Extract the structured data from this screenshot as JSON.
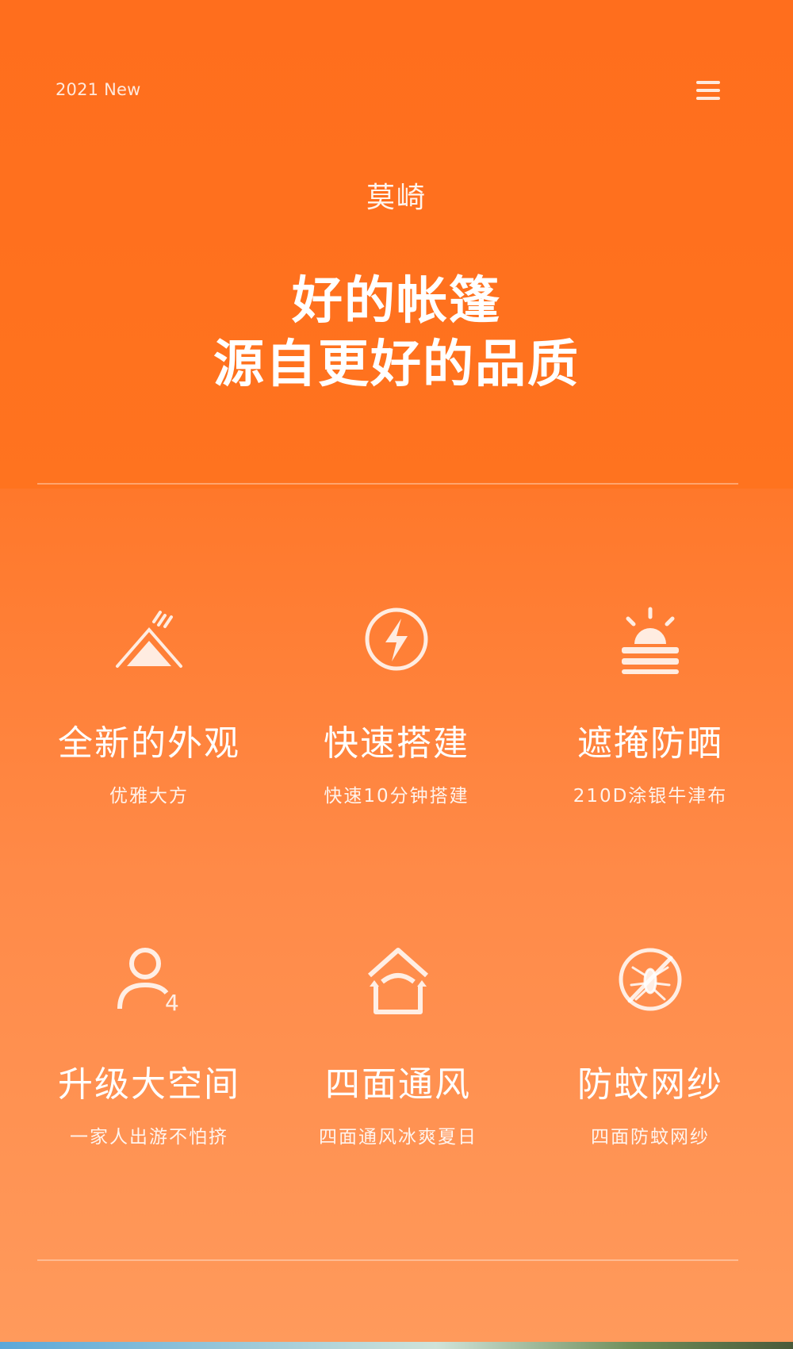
{
  "header": {
    "badge": "2021 New",
    "menu_icon": "menu-icon"
  },
  "hero": {
    "brand": "莫崎",
    "headline_line1": "好的帐篷",
    "headline_line2": "源自更好的品质"
  },
  "features": [
    {
      "icon": "tent-icon",
      "title": "全新的外观",
      "subtitle": "优雅大方"
    },
    {
      "icon": "lightning-icon",
      "title": "快速搭建",
      "subtitle": "快速10分钟搭建"
    },
    {
      "icon": "sun-shade-icon",
      "title": "遮掩防晒",
      "subtitle": "210D涂银牛津布"
    },
    {
      "icon": "user-four-icon",
      "title": "升级大空间",
      "subtitle": "一家人出游不怕挤"
    },
    {
      "icon": "ventilation-house-icon",
      "title": "四面通风",
      "subtitle": "四面通风冰爽夏日"
    },
    {
      "icon": "no-mosquito-icon",
      "title": "防蚊网纱",
      "subtitle": "四面防蚊网纱"
    }
  ],
  "colors": {
    "accent": "#ff6e1d",
    "text": "#ffffff"
  }
}
